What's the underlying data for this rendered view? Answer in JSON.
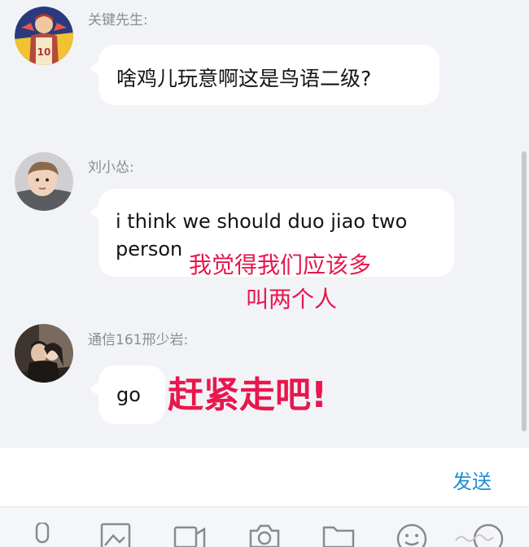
{
  "messages": [
    {
      "sender": "关键先生:",
      "avatar_icon": "basketball-player-avatar",
      "text_lines": [
        "啥鸡儿玩意啊这是鸟语二级?"
      ]
    },
    {
      "sender": "刘小怂:",
      "avatar_icon": "child-photo-avatar",
      "text_lines": [
        "i think we should duo jiao two",
        "person"
      ],
      "annotation_lines": [
        "我觉得我们应该多",
        "叫两个人"
      ]
    },
    {
      "sender": "通信161邢少岩:",
      "avatar_icon": "couple-photo-avatar",
      "text_lines": [
        "go"
      ],
      "annotation_lines": [
        "赶紧走吧!"
      ]
    }
  ],
  "input": {
    "send_label": "发送"
  },
  "toolbar": {
    "icons": [
      "microphone-icon",
      "image-icon",
      "video-icon",
      "camera-icon",
      "folder-icon",
      "emoji-icon",
      "more-icon"
    ]
  },
  "colors": {
    "background": "#f2f3f7",
    "bubble": "#ffffff",
    "annotation": "#e8174d",
    "send": "#1e8fd0"
  }
}
